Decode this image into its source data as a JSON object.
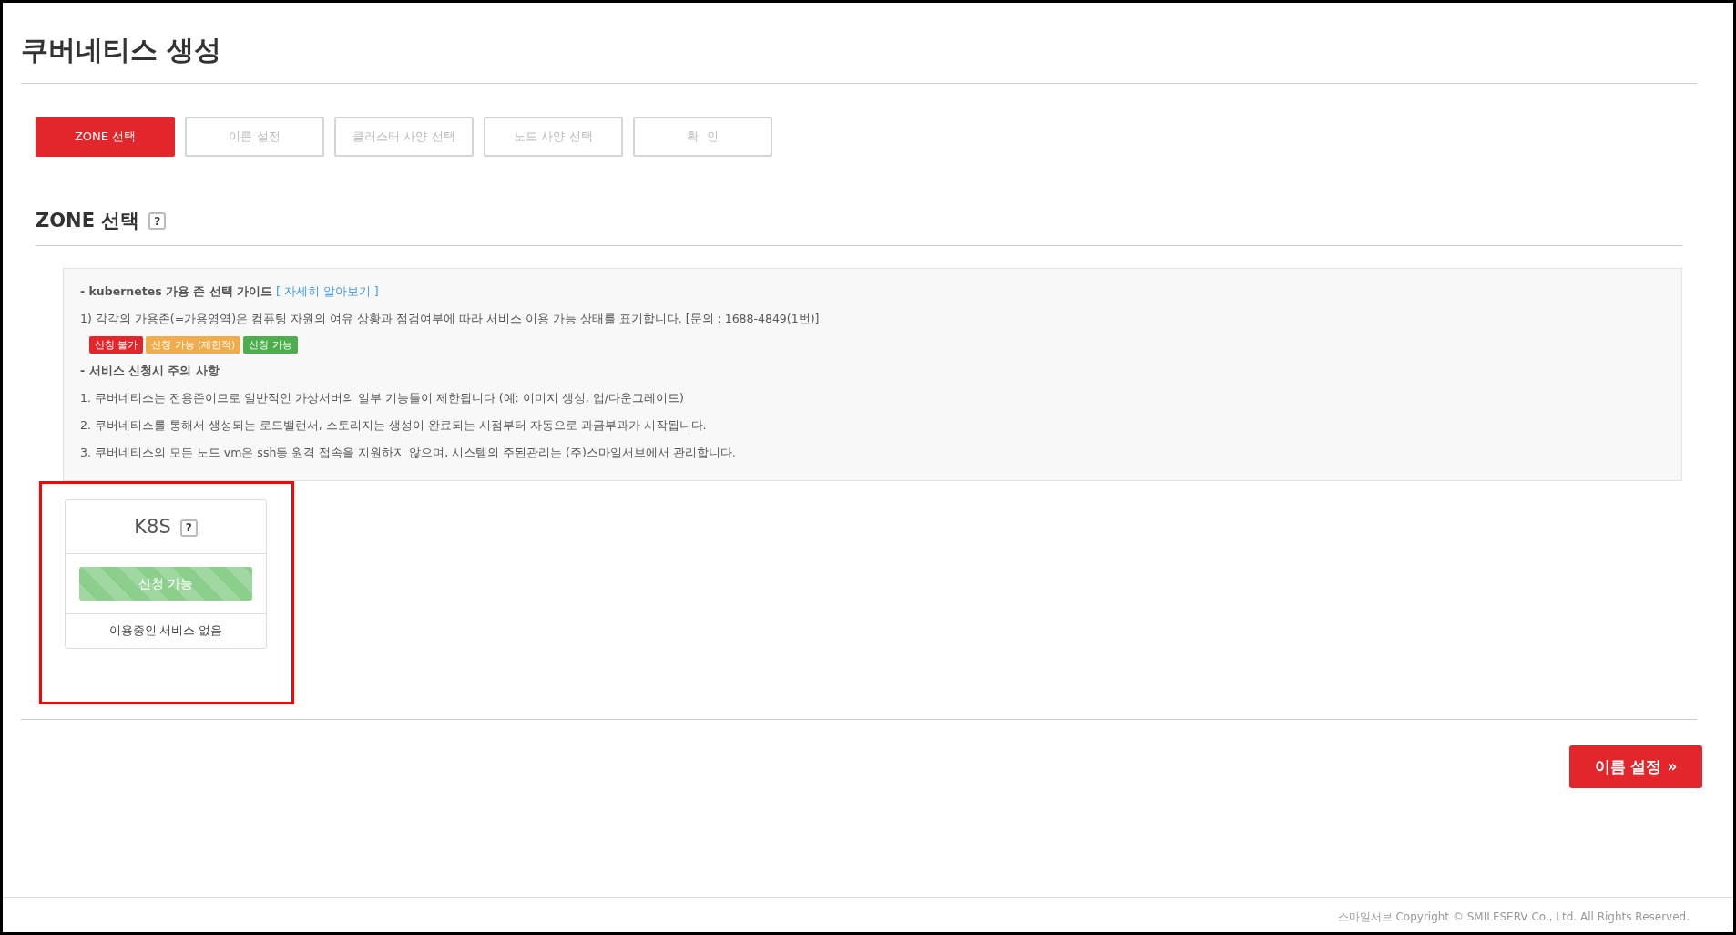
{
  "page_title": "쿠버네티스 생성",
  "steps": [
    {
      "label": "ZONE 선택",
      "selected": true
    },
    {
      "label": "이름 설정",
      "selected": false
    },
    {
      "label": "클러스터 사양 선택",
      "selected": false
    },
    {
      "label": "노드 사양 선택",
      "selected": false
    },
    {
      "label": "확  인",
      "selected": false
    }
  ],
  "section": {
    "title": "ZONE 선택",
    "help": "?"
  },
  "guide": {
    "heading": "- kubernetes 가용 존 선택 가이드",
    "link": "[ 자세히 알아보기 ]",
    "description": "1) 각각의 가용존(=가용영역)은 컴퓨팅 자원의 여유 상황과 점검여부에 따라 서비스 이용 가능 상태를 표기합니다. [문의 : 1688-4849(1번)]",
    "legend": [
      {
        "label": "신청 불가",
        "color": "#e3262b"
      },
      {
        "label": "신청 가능 (제한적)",
        "color": "#f0ad4e"
      },
      {
        "label": "신청 가능",
        "color": "#4cae4c"
      }
    ],
    "notice_heading": "- 서비스 신청시 주의 사항",
    "notices": [
      "1. 쿠버네티스는 전용존이므로 일반적인 가상서버의 일부 기능들이 제한됩니다 (예: 이미지 생성, 업/다운그레이드)",
      "2. 쿠버네티스를 통해서 생성되는 로드밸런서, 스토리지는 생성이 완료되는 시점부터 자동으로 과금부과가 시작됩니다.",
      "3. 쿠버네티스의 모든 노드 vm은 ssh등 원격 접속을 지원하지 않으며, 시스템의 주된관리는 (주)스마일서브에서 관리합니다."
    ]
  },
  "zones": [
    {
      "name": "K8S",
      "help": "?",
      "status": "신청 가능",
      "color": "#8ccf8c",
      "usage": "이용중인 서비스 없음",
      "highlighted": true
    }
  ],
  "next_button": {
    "label": "이름 설정",
    "icon": "»"
  },
  "footer": "스마일서브 Copyright © SMILESERV Co., Ltd. All Rights Reserved."
}
